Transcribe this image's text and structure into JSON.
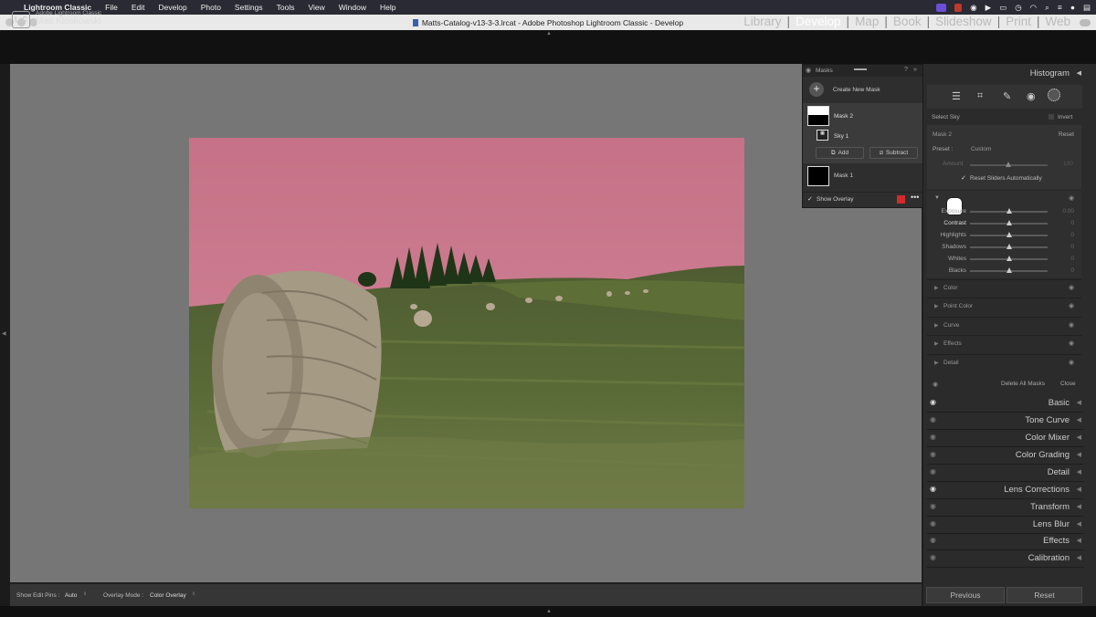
{
  "menubar": {
    "app": "Lightroom Classic",
    "items": [
      "File",
      "Edit",
      "Develop",
      "Photo",
      "Settings",
      "Tools",
      "View",
      "Window",
      "Help"
    ]
  },
  "window": {
    "title": "Matts-Catalog-v13-3-3.lrcat - Adobe Photoshop Lightroom Classic - Develop"
  },
  "header": {
    "logo": "LrC",
    "product": "Adobe Lightroom Classic",
    "user": "Matt Kloskowski",
    "modules": [
      "Library",
      "Develop",
      "Map",
      "Book",
      "Slideshow",
      "Print",
      "Web"
    ],
    "active_module": "Develop"
  },
  "masks_panel": {
    "title": "Masks",
    "create_label": "Create New Mask",
    "mask2": "Mask 2",
    "sky": "Sky 1",
    "add": "Add",
    "subtract": "Subtract",
    "mask1": "Mask 1",
    "show_overlay": "Show Overlay",
    "overlay_color": "#d12a2a"
  },
  "toolbar": {
    "show_edit_pins_label": "Show Edit Pins :",
    "show_edit_pins_value": "Auto",
    "overlay_mode_label": "Overlay Mode :",
    "overlay_mode_value": "Color Overlay"
  },
  "right": {
    "histogram": "Histogram",
    "select_sky": "Select Sky",
    "invert": "Invert",
    "mask_name": "Mask 2",
    "reset": "Reset",
    "preset_label": "Preset :",
    "preset_value": "Custom",
    "amount_label": "Amount",
    "amount_value": "100",
    "reset_sliders": "Reset Sliders Automatically",
    "sliders": [
      {
        "label": "Exposure",
        "value": "0.00",
        "pos": 0.5
      },
      {
        "label": "Contrast",
        "value": "0",
        "pos": 0.5
      },
      {
        "label": "Highlights",
        "value": "0",
        "pos": 0.5
      },
      {
        "label": "Shadows",
        "value": "0",
        "pos": 0.5
      },
      {
        "label": "Whites",
        "value": "0",
        "pos": 0.5
      },
      {
        "label": "Blacks",
        "value": "0",
        "pos": 0.5
      }
    ],
    "sections": [
      "Color",
      "Point Color",
      "Curve",
      "Effects",
      "Detail"
    ],
    "delete_all": "Delete All Masks",
    "close": "Close",
    "panels": [
      "Basic",
      "Tone Curve",
      "Color Mixer",
      "Color Grading",
      "Detail",
      "Lens Corrections",
      "Transform",
      "Lens Blur",
      "Effects",
      "Calibration"
    ],
    "previous": "Previous",
    "reset_btn": "Reset"
  }
}
